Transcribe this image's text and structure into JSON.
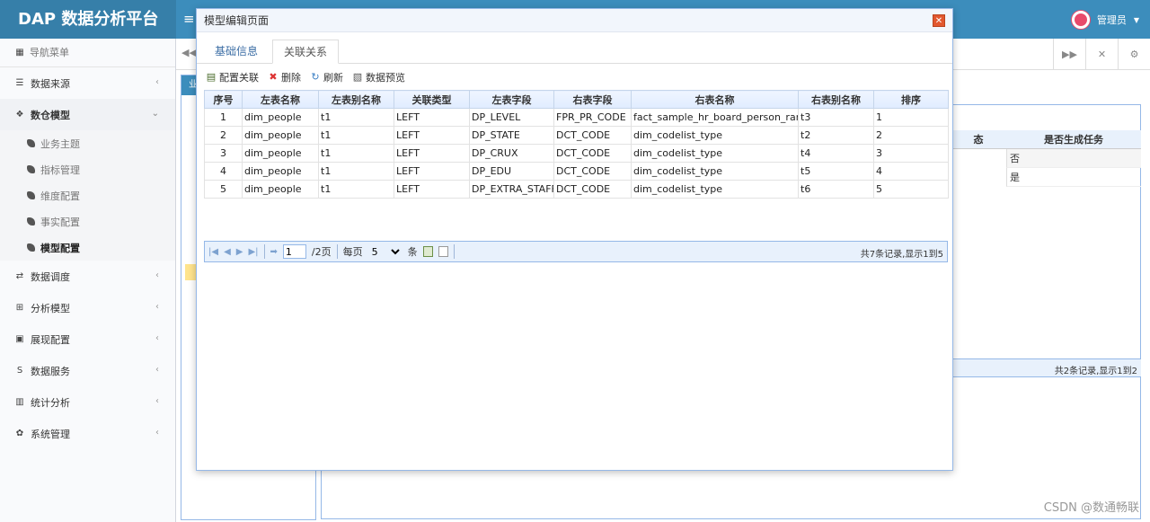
{
  "app": {
    "brand": "DAP 数据分析平台",
    "user": "管理员"
  },
  "sidebar": {
    "nav_header": "导航菜单",
    "items": [
      {
        "label": "数据来源",
        "icon": "database-icon"
      },
      {
        "label": "数仓模型",
        "icon": "cubes-icon",
        "expanded": true,
        "children": [
          "业务主题",
          "指标管理",
          "维度配置",
          "事实配置",
          "模型配置"
        ],
        "active_child": "模型配置"
      },
      {
        "label": "数据调度",
        "icon": "shuffle-icon"
      },
      {
        "label": "分析模型",
        "icon": "chart-model-icon"
      },
      {
        "label": "展现配置",
        "icon": "film-icon"
      },
      {
        "label": "数据服务",
        "icon": "dollar-icon"
      },
      {
        "label": "统计分析",
        "icon": "bar-chart-icon"
      },
      {
        "label": "系统管理",
        "icon": "gear-icon"
      }
    ]
  },
  "background": {
    "left_title": "业",
    "grid_headers": [
      "态",
      "是否生成任务"
    ],
    "rows": [
      "否",
      "是"
    ],
    "pager_info": "共2条记录,显示1到2"
  },
  "modal": {
    "title": "模型编辑页面",
    "tabs": [
      "基础信息",
      "关联关系"
    ],
    "active_tab": 1,
    "toolbar": [
      "配置关联",
      "删除",
      "刷新",
      "数据预览"
    ],
    "columns": [
      "序号",
      "左表名称",
      "左表别名称",
      "关联类型",
      "左表字段",
      "右表字段",
      "右表名称",
      "右表别名称",
      "排序"
    ],
    "rows": [
      [
        "1",
        "dim_people",
        "t1",
        "LEFT",
        "DP_LEVEL",
        "FPR_PR_CODE",
        "fact_sample_hr_board_person_rank",
        "t3",
        "1"
      ],
      [
        "2",
        "dim_people",
        "t1",
        "LEFT",
        "DP_STATE",
        "DCT_CODE",
        "dim_codelist_type",
        "t2",
        "2"
      ],
      [
        "3",
        "dim_people",
        "t1",
        "LEFT",
        "DP_CRUX",
        "DCT_CODE",
        "dim_codelist_type",
        "t4",
        "3"
      ],
      [
        "4",
        "dim_people",
        "t1",
        "LEFT",
        "DP_EDU",
        "DCT_CODE",
        "dim_codelist_type",
        "t5",
        "4"
      ],
      [
        "5",
        "dim_people",
        "t1",
        "LEFT",
        "DP_EXTRA_STAFF",
        "DCT_CODE",
        "dim_codelist_type",
        "t6",
        "5"
      ]
    ],
    "pager": {
      "page": "1",
      "total_pages": "/2页",
      "per_page_label": "每页",
      "per_page": "5",
      "per_page_unit": "条",
      "info": "共7条记录,显示1到5"
    }
  },
  "watermark": "CSDN @数通畅联"
}
